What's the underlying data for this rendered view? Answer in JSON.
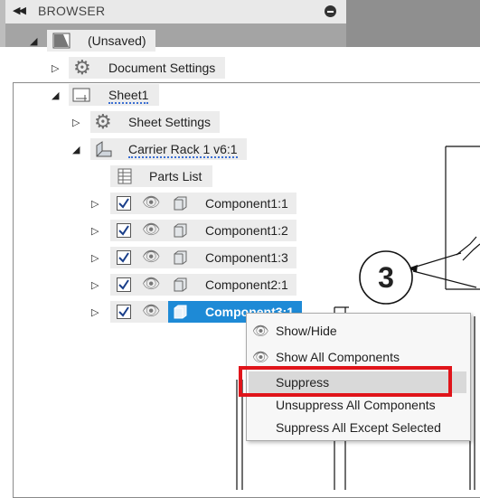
{
  "browser": {
    "title": "BROWSER",
    "root_label": "(Unsaved)",
    "document_settings": "Document Settings",
    "sheet": "Sheet1",
    "sheet_settings": "Sheet Settings",
    "view": "Carrier Rack 1 v6:1",
    "parts_list": "Parts List",
    "components": [
      {
        "label": "Component1:1",
        "checked": true
      },
      {
        "label": "Component1:2",
        "checked": true
      },
      {
        "label": "Component1:3",
        "checked": true
      },
      {
        "label": "Component2:1",
        "checked": true
      },
      {
        "label": "Component3:1",
        "checked": true,
        "selected": true
      }
    ]
  },
  "balloon": {
    "number": "3"
  },
  "context_menu": {
    "items": [
      {
        "label": "Show/Hide",
        "icon": "eye-icon"
      },
      {
        "label": "Show All Components",
        "icon": "eye-icon"
      },
      {
        "label": "Suppress",
        "highlighted": true
      },
      {
        "label": "Unsuppress All Components"
      },
      {
        "label": "Suppress All Except Selected"
      }
    ]
  },
  "colors": {
    "selection": "#1e8ad6",
    "highlight_border": "#e0141a"
  }
}
